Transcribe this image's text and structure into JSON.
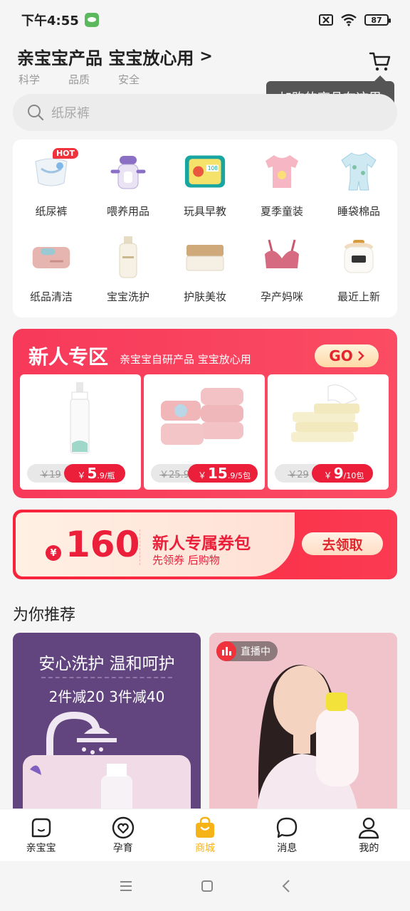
{
  "status": {
    "time": "下午4:55",
    "battery": "87"
  },
  "header": {
    "slogan": "亲宝宝产品 宝宝放心用",
    "arrow": ">",
    "tags": [
      "科学",
      "品质",
      "安全"
    ],
    "cart_tooltip": "加购的商品在这里"
  },
  "search": {
    "placeholder": "纸尿裤"
  },
  "categories": [
    {
      "label": "纸尿裤",
      "badge": "HOT"
    },
    {
      "label": "喂养用品"
    },
    {
      "label": "玩具早教"
    },
    {
      "label": "夏季童装"
    },
    {
      "label": "睡袋棉品"
    },
    {
      "label": "纸品清洁"
    },
    {
      "label": "宝宝洗护"
    },
    {
      "label": "护肤美妆"
    },
    {
      "label": "孕产妈咪"
    },
    {
      "label": "最近上新"
    }
  ],
  "new_zone": {
    "title": "新人专区",
    "subtitle": "亲宝宝自研产品 宝宝放心用",
    "go_label": "GO",
    "products": [
      {
        "old_price": "￥19",
        "currency": "￥",
        "price": "5",
        "unit": ".9/瓶"
      },
      {
        "old_price": "￥25.9",
        "currency": "￥",
        "price": "15",
        "unit": ".9/5包"
      },
      {
        "old_price": "￥29",
        "currency": "￥",
        "price": "9",
        "unit": "/10包"
      }
    ]
  },
  "coupon": {
    "currency": "¥",
    "amount": "160",
    "title": "新人专属券包",
    "subtitle": "先领券 后购物",
    "button": "去领取"
  },
  "recommend": {
    "title": "为你推荐",
    "left": {
      "headline": "安心洗护 温和呵护",
      "promo": "2件减20 3件减40"
    },
    "right": {
      "live_label": "直播中"
    }
  },
  "tabbar": [
    {
      "label": "亲宝宝",
      "icon": "face-icon"
    },
    {
      "label": "孕育",
      "icon": "heart-circle-icon"
    },
    {
      "label": "商城",
      "icon": "shopping-bag-icon",
      "active": true
    },
    {
      "label": "消息",
      "icon": "chat-bubble-icon"
    },
    {
      "label": "我的",
      "icon": "person-icon"
    }
  ],
  "colors": {
    "brand_red": "#ec1f3a",
    "active_tab": "#f5b317",
    "tooltip_bg": "#555555"
  }
}
